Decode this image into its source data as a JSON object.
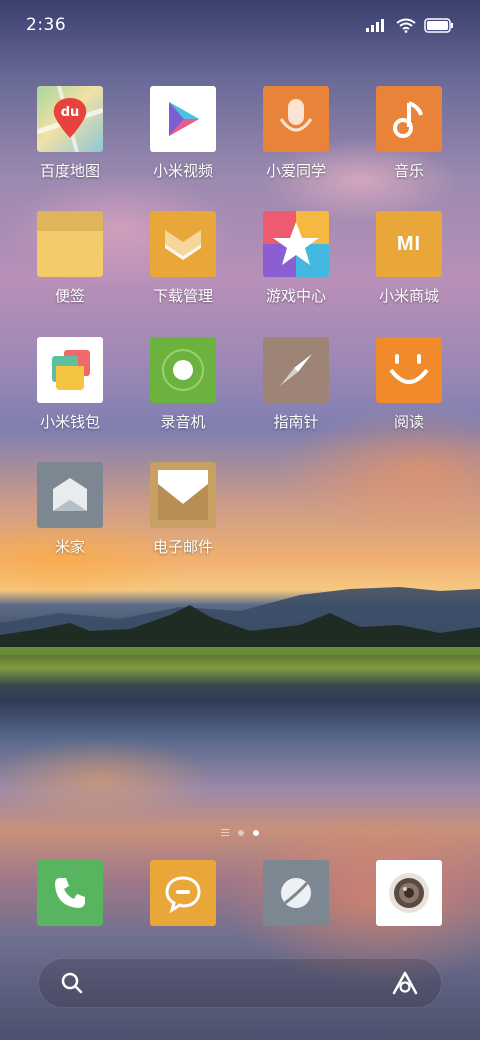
{
  "status_bar": {
    "time": "2:36",
    "icons": [
      "signal-icon",
      "wifi-icon",
      "battery-icon"
    ]
  },
  "apps": [
    {
      "label": "百度地图",
      "icon": "baidu-map-icon",
      "icon_text": "du"
    },
    {
      "label": "小米视频",
      "icon": "mi-video-icon"
    },
    {
      "label": "小爱同学",
      "icon": "xiaoai-icon"
    },
    {
      "label": "音乐",
      "icon": "music-icon"
    },
    {
      "label": "便签",
      "icon": "notes-icon"
    },
    {
      "label": "下载管理",
      "icon": "download-manager-icon"
    },
    {
      "label": "游戏中心",
      "icon": "game-center-icon"
    },
    {
      "label": "小米商城",
      "icon": "mi-store-icon",
      "icon_text": "MI"
    },
    {
      "label": "小米钱包",
      "icon": "mi-wallet-icon"
    },
    {
      "label": "录音机",
      "icon": "recorder-icon"
    },
    {
      "label": "指南针",
      "icon": "compass-icon"
    },
    {
      "label": "阅读",
      "icon": "reader-icon"
    },
    {
      "label": "米家",
      "icon": "mijia-icon"
    },
    {
      "label": "电子邮件",
      "icon": "email-icon"
    }
  ],
  "page_indicator": {
    "pages": 2,
    "active": 2
  },
  "dock": [
    {
      "icon": "phone-icon"
    },
    {
      "icon": "messages-icon"
    },
    {
      "icon": "browser-icon"
    },
    {
      "icon": "camera-icon"
    }
  ],
  "search_bar": {
    "left_icon": "search-icon",
    "right_icon": "xiaoai-assistant-icon"
  },
  "colors": {
    "map": "#8fc7d8",
    "video": "#ffffff",
    "xiaoai": "#e9833a",
    "music": "#e9833a",
    "notes": "#f2cc6b",
    "download": "#e9a73a",
    "store": "#e9a73a",
    "recorder": "#6cb23e",
    "compass": "#9e8377",
    "reader": "#f08a2a",
    "mijia": "#7c8791",
    "email": "#c9a064",
    "phone": "#56b55e",
    "messages": "#e9a73a",
    "browser": "#7c8791",
    "camera": "#ffffff"
  }
}
